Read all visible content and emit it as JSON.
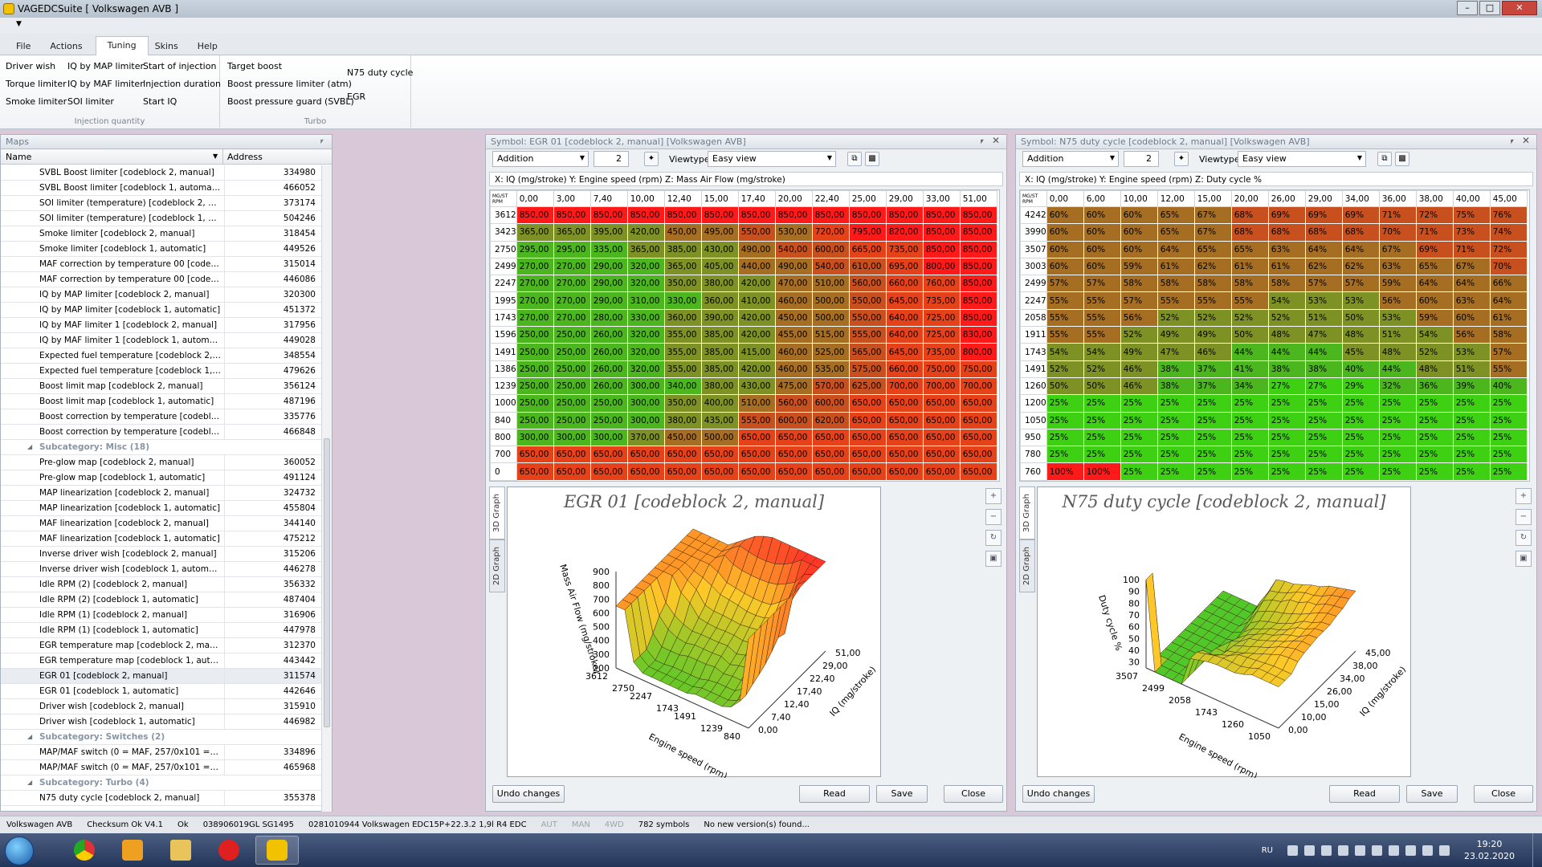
{
  "window": {
    "title": "VAGEDCSuite [ Volkswagen AVB ]"
  },
  "menu": [
    "File",
    "Actions",
    "Tuning",
    "Skins",
    "Help"
  ],
  "ribbon": {
    "injection": {
      "items": [
        "Driver wish",
        "IQ by MAP limiter",
        "Start of injection",
        "Torque limiter",
        "IQ by MAF limiter",
        "Injection duration",
        "Smoke limiter",
        "SOI limiter",
        "Start IQ"
      ],
      "label": "Injection quantity"
    },
    "turbo": {
      "items": [
        "Target boost",
        "Boost pressure limiter (atm)",
        "Boost pressure guard (SVBL)"
      ],
      "label": "Turbo"
    },
    "other": [
      "N75 duty cycle",
      "EGR"
    ]
  },
  "maps_panel": {
    "title": "Maps",
    "col_name": "Name",
    "col_address": "Address",
    "rows": [
      {
        "name": "SVBL Boost limiter [codeblock 2, manual]",
        "addr": "334980"
      },
      {
        "name": "SVBL Boost limiter [codeblock 1, automatic]",
        "addr": "466052"
      },
      {
        "name": "SOI limiter (temperature) [codeblock 2, man...",
        "addr": "373174"
      },
      {
        "name": "SOI limiter (temperature) [codeblock 1, auto...",
        "addr": "504246"
      },
      {
        "name": "Smoke limiter [codeblock 2, manual]",
        "addr": "318454"
      },
      {
        "name": "Smoke limiter [codeblock 1, automatic]",
        "addr": "449526"
      },
      {
        "name": "MAF correction by temperature 00 [codebloc...",
        "addr": "315014"
      },
      {
        "name": "MAF correction by temperature 00 [codebloc...",
        "addr": "446086"
      },
      {
        "name": "IQ by MAP limiter [codeblock 2, manual]",
        "addr": "320300"
      },
      {
        "name": "IQ by MAP limiter [codeblock 1, automatic]",
        "addr": "451372"
      },
      {
        "name": "IQ by MAF limiter 1 [codeblock 2, manual]",
        "addr": "317956"
      },
      {
        "name": "IQ by MAF limiter 1 [codeblock 1, automatic]",
        "addr": "449028"
      },
      {
        "name": "Expected fuel temperature [codeblock 2, ma...",
        "addr": "348554"
      },
      {
        "name": "Expected fuel temperature [codeblock 1, au...",
        "addr": "479626"
      },
      {
        "name": "Boost limit map [codeblock 2, manual]",
        "addr": "356124"
      },
      {
        "name": "Boost limit map [codeblock 1, automatic]",
        "addr": "487196"
      },
      {
        "name": "Boost correction by temperature [codeblock ...",
        "addr": "335776"
      },
      {
        "name": "Boost correction by temperature [codeblock ...",
        "addr": "466848"
      },
      {
        "name": "Subcategory: Misc (18)",
        "addr": "",
        "sub": true
      },
      {
        "name": "Pre-glow map [codeblock 2, manual]",
        "addr": "360052"
      },
      {
        "name": "Pre-glow map [codeblock 1, automatic]",
        "addr": "491124"
      },
      {
        "name": "MAP linearization [codeblock 2, manual]",
        "addr": "324732"
      },
      {
        "name": "MAP linearization [codeblock 1, automatic]",
        "addr": "455804"
      },
      {
        "name": "MAF linearization [codeblock 2, manual]",
        "addr": "344140"
      },
      {
        "name": "MAF linearization [codeblock 1, automatic]",
        "addr": "475212"
      },
      {
        "name": "Inverse driver wish [codeblock 2, manual]",
        "addr": "315206"
      },
      {
        "name": "Inverse driver wish [codeblock 1, automatic]",
        "addr": "446278"
      },
      {
        "name": "Idle RPM (2) [codeblock 2, manual]",
        "addr": "356332"
      },
      {
        "name": "Idle RPM (2) [codeblock 1, automatic]",
        "addr": "487404"
      },
      {
        "name": "Idle RPM (1) [codeblock 2, manual]",
        "addr": "316906"
      },
      {
        "name": "Idle RPM (1) [codeblock 1, automatic]",
        "addr": "447978"
      },
      {
        "name": "EGR temperature map [codeblock 2, manual]",
        "addr": "312370"
      },
      {
        "name": "EGR temperature map [codeblock 1, automa...",
        "addr": "443442"
      },
      {
        "name": "EGR 01 [codeblock 2, manual]",
        "addr": "311574",
        "sel": true
      },
      {
        "name": "EGR 01 [codeblock 1, automatic]",
        "addr": "442646"
      },
      {
        "name": "Driver wish [codeblock 2, manual]",
        "addr": "315910"
      },
      {
        "name": "Driver wish [codeblock 1, automatic]",
        "addr": "446982"
      },
      {
        "name": "Subcategory: Switches (2)",
        "addr": "",
        "sub": true
      },
      {
        "name": "MAP/MAF switch (0 = MAF, 257/0x101 = M...",
        "addr": "334896"
      },
      {
        "name": "MAP/MAF switch (0 = MAF, 257/0x101 = M...",
        "addr": "465968"
      },
      {
        "name": "Subcategory: Turbo (4)",
        "addr": "",
        "sub": true
      },
      {
        "name": "N75 duty cycle [codeblock 2, manual]",
        "addr": "355378"
      }
    ]
  },
  "egr_panel": {
    "title": "Symbol: EGR 01 [codeblock 2, manual] [Volkswagen AVB]",
    "mode": "Addition",
    "step": "2",
    "viewtype_label": "Viewtype",
    "viewtype": "Easy view",
    "axis_info": "X: IQ (mg/stroke) Y: Engine speed (rpm) Z: Mass Air Flow (mg/stroke)",
    "corner_top": "MG/ST",
    "corner_bottom": "RPM",
    "cols": [
      "0,00",
      "3,00",
      "7,40",
      "10,00",
      "12,40",
      "15,00",
      "17,40",
      "20,00",
      "22,40",
      "25,00",
      "29,00",
      "33,00",
      "51,00"
    ],
    "rows": [
      {
        "rpm": "3612",
        "v": [
          "850,00",
          "850,00",
          "850,00",
          "850,00",
          "850,00",
          "850,00",
          "850,00",
          "850,00",
          "850,00",
          "850,00",
          "850,00",
          "850,00",
          "850,00"
        ]
      },
      {
        "rpm": "3423",
        "v": [
          "365,00",
          "365,00",
          "395,00",
          "420,00",
          "450,00",
          "495,00",
          "550,00",
          "530,00",
          "720,00",
          "795,00",
          "820,00",
          "850,00",
          "850,00"
        ]
      },
      {
        "rpm": "2750",
        "v": [
          "295,00",
          "295,00",
          "335,00",
          "365,00",
          "385,00",
          "430,00",
          "490,00",
          "540,00",
          "600,00",
          "665,00",
          "735,00",
          "850,00",
          "850,00"
        ]
      },
      {
        "rpm": "2499",
        "v": [
          "270,00",
          "270,00",
          "290,00",
          "320,00",
          "365,00",
          "405,00",
          "440,00",
          "490,00",
          "540,00",
          "610,00",
          "695,00",
          "800,00",
          "850,00"
        ]
      },
      {
        "rpm": "2247",
        "v": [
          "270,00",
          "270,00",
          "290,00",
          "320,00",
          "350,00",
          "380,00",
          "420,00",
          "470,00",
          "510,00",
          "560,00",
          "660,00",
          "760,00",
          "850,00"
        ]
      },
      {
        "rpm": "1995",
        "v": [
          "270,00",
          "270,00",
          "290,00",
          "310,00",
          "330,00",
          "360,00",
          "410,00",
          "460,00",
          "500,00",
          "550,00",
          "645,00",
          "735,00",
          "850,00"
        ]
      },
      {
        "rpm": "1743",
        "v": [
          "270,00",
          "270,00",
          "280,00",
          "330,00",
          "360,00",
          "390,00",
          "420,00",
          "450,00",
          "500,00",
          "550,00",
          "640,00",
          "725,00",
          "850,00"
        ]
      },
      {
        "rpm": "1596",
        "v": [
          "250,00",
          "250,00",
          "260,00",
          "320,00",
          "355,00",
          "385,00",
          "420,00",
          "455,00",
          "515,00",
          "555,00",
          "640,00",
          "725,00",
          "830,00"
        ]
      },
      {
        "rpm": "1491",
        "v": [
          "250,00",
          "250,00",
          "260,00",
          "320,00",
          "355,00",
          "385,00",
          "415,00",
          "460,00",
          "525,00",
          "565,00",
          "645,00",
          "735,00",
          "800,00"
        ]
      },
      {
        "rpm": "1386",
        "v": [
          "250,00",
          "250,00",
          "260,00",
          "320,00",
          "355,00",
          "385,00",
          "420,00",
          "460,00",
          "535,00",
          "575,00",
          "660,00",
          "750,00",
          "750,00"
        ]
      },
      {
        "rpm": "1239",
        "v": [
          "250,00",
          "250,00",
          "260,00",
          "300,00",
          "340,00",
          "380,00",
          "430,00",
          "475,00",
          "570,00",
          "625,00",
          "700,00",
          "700,00",
          "700,00"
        ]
      },
      {
        "rpm": "1000",
        "v": [
          "250,00",
          "250,00",
          "250,00",
          "300,00",
          "350,00",
          "400,00",
          "510,00",
          "560,00",
          "600,00",
          "650,00",
          "650,00",
          "650,00",
          "650,00"
        ]
      },
      {
        "rpm": "840",
        "v": [
          "250,00",
          "250,00",
          "250,00",
          "300,00",
          "380,00",
          "435,00",
          "555,00",
          "600,00",
          "620,00",
          "650,00",
          "650,00",
          "650,00",
          "650,00"
        ]
      },
      {
        "rpm": "800",
        "v": [
          "300,00",
          "300,00",
          "300,00",
          "370,00",
          "450,00",
          "500,00",
          "650,00",
          "650,00",
          "650,00",
          "650,00",
          "650,00",
          "650,00",
          "650,00"
        ]
      },
      {
        "rpm": "700",
        "v": [
          "650,00",
          "650,00",
          "650,00",
          "650,00",
          "650,00",
          "650,00",
          "650,00",
          "650,00",
          "650,00",
          "650,00",
          "650,00",
          "650,00",
          "650,00"
        ]
      },
      {
        "rpm": "0",
        "v": [
          "650,00",
          "650,00",
          "650,00",
          "650,00",
          "650,00",
          "650,00",
          "650,00",
          "650,00",
          "650,00",
          "650,00",
          "650,00",
          "650,00",
          "650,00"
        ]
      }
    ],
    "graph_title": "EGR 01 [codeblock 2, manual]",
    "tab_3d": "3D Graph",
    "tab_2d": "2D Graph",
    "z_label": "Mass Air Flow (mg/stroke)",
    "z_ticks": [
      "900",
      "800",
      "700",
      "600",
      "500",
      "400",
      "300",
      "200"
    ],
    "y_label": "Engine speed (rpm)",
    "y_ticks": [
      "3612",
      "2750",
      "2247",
      "1743",
      "1491",
      "1239",
      "840"
    ],
    "x_label": "IQ (mg/stroke)",
    "x_ticks": [
      "51,00",
      "29,00",
      "22,40",
      "17,40",
      "12,40",
      "7,40",
      "0,00"
    ],
    "btn_undo": "Undo changes",
    "btn_read": "Read",
    "btn_save": "Save",
    "btn_close": "Close"
  },
  "n75_panel": {
    "title": "Symbol: N75 duty cycle [codeblock 2, manual] [Volkswagen AVB]",
    "mode": "Addition",
    "step": "2",
    "viewtype_label": "Viewtype",
    "viewtype": "Easy view",
    "axis_info": "X: IQ (mg/stroke) Y: Engine speed (rpm) Z: Duty cycle %",
    "corner_top": "MG/ST",
    "corner_bottom": "RPM",
    "cols": [
      "0,00",
      "6,00",
      "10,00",
      "12,00",
      "15,00",
      "20,00",
      "26,00",
      "29,00",
      "34,00",
      "36,00",
      "38,00",
      "40,00",
      "45,00"
    ],
    "rows": [
      {
        "rpm": "4242",
        "v": [
          "60%",
          "60%",
          "60%",
          "65%",
          "67%",
          "68%",
          "69%",
          "69%",
          "69%",
          "71%",
          "72%",
          "75%",
          "76%"
        ]
      },
      {
        "rpm": "3990",
        "v": [
          "60%",
          "60%",
          "60%",
          "65%",
          "67%",
          "68%",
          "68%",
          "68%",
          "68%",
          "70%",
          "71%",
          "73%",
          "74%"
        ]
      },
      {
        "rpm": "3507",
        "v": [
          "60%",
          "60%",
          "60%",
          "64%",
          "65%",
          "65%",
          "63%",
          "64%",
          "64%",
          "67%",
          "69%",
          "71%",
          "72%"
        ]
      },
      {
        "rpm": "3003",
        "v": [
          "60%",
          "60%",
          "59%",
          "61%",
          "62%",
          "61%",
          "61%",
          "62%",
          "62%",
          "63%",
          "65%",
          "67%",
          "70%"
        ]
      },
      {
        "rpm": "2499",
        "v": [
          "57%",
          "57%",
          "58%",
          "58%",
          "58%",
          "58%",
          "58%",
          "57%",
          "57%",
          "59%",
          "64%",
          "64%",
          "66%"
        ]
      },
      {
        "rpm": "2247",
        "v": [
          "55%",
          "55%",
          "57%",
          "55%",
          "55%",
          "55%",
          "54%",
          "53%",
          "53%",
          "56%",
          "60%",
          "63%",
          "64%"
        ]
      },
      {
        "rpm": "2058",
        "v": [
          "55%",
          "55%",
          "56%",
          "52%",
          "52%",
          "52%",
          "52%",
          "51%",
          "50%",
          "53%",
          "59%",
          "60%",
          "61%"
        ]
      },
      {
        "rpm": "1911",
        "v": [
          "55%",
          "55%",
          "52%",
          "49%",
          "49%",
          "50%",
          "48%",
          "47%",
          "48%",
          "51%",
          "54%",
          "56%",
          "58%"
        ]
      },
      {
        "rpm": "1743",
        "v": [
          "54%",
          "54%",
          "49%",
          "47%",
          "46%",
          "44%",
          "44%",
          "44%",
          "45%",
          "48%",
          "52%",
          "53%",
          "57%"
        ]
      },
      {
        "rpm": "1491",
        "v": [
          "52%",
          "52%",
          "46%",
          "38%",
          "37%",
          "41%",
          "38%",
          "38%",
          "40%",
          "44%",
          "48%",
          "51%",
          "55%"
        ]
      },
      {
        "rpm": "1260",
        "v": [
          "50%",
          "50%",
          "46%",
          "38%",
          "37%",
          "34%",
          "27%",
          "27%",
          "29%",
          "32%",
          "36%",
          "39%",
          "40%"
        ]
      },
      {
        "rpm": "1200",
        "v": [
          "25%",
          "25%",
          "25%",
          "25%",
          "25%",
          "25%",
          "25%",
          "25%",
          "25%",
          "25%",
          "25%",
          "25%",
          "25%"
        ]
      },
      {
        "rpm": "1050",
        "v": [
          "25%",
          "25%",
          "25%",
          "25%",
          "25%",
          "25%",
          "25%",
          "25%",
          "25%",
          "25%",
          "25%",
          "25%",
          "25%"
        ]
      },
      {
        "rpm": "950",
        "v": [
          "25%",
          "25%",
          "25%",
          "25%",
          "25%",
          "25%",
          "25%",
          "25%",
          "25%",
          "25%",
          "25%",
          "25%",
          "25%"
        ]
      },
      {
        "rpm": "780",
        "v": [
          "25%",
          "25%",
          "25%",
          "25%",
          "25%",
          "25%",
          "25%",
          "25%",
          "25%",
          "25%",
          "25%",
          "25%",
          "25%"
        ]
      },
      {
        "rpm": "760",
        "v": [
          "100%",
          "100%",
          "25%",
          "25%",
          "25%",
          "25%",
          "25%",
          "25%",
          "25%",
          "25%",
          "25%",
          "25%",
          "25%"
        ]
      }
    ],
    "graph_title": "N75 duty cycle [codeblock 2, manual]",
    "tab_3d": "3D Graph",
    "tab_2d": "2D Graph",
    "z_label": "Duty cycle %",
    "z_ticks": [
      "100",
      "90",
      "80",
      "70",
      "60",
      "50",
      "40",
      "30"
    ],
    "y_label": "Engine speed (rpm)",
    "y_ticks": [
      "3507",
      "2499",
      "2058",
      "1743",
      "1260",
      "1050"
    ],
    "x_label": "IQ (mg/stroke)",
    "x_ticks": [
      "45,00",
      "38,00",
      "34,00",
      "26,00",
      "15,00",
      "10,00",
      "0,00"
    ],
    "btn_undo": "Undo changes",
    "btn_read": "Read",
    "btn_save": "Save",
    "btn_close": "Close"
  },
  "statusbar": {
    "car": "Volkswagen AVB",
    "checksum": "Checksum Ok V4.1",
    "ok": "Ok",
    "partno": "038906019GL SG1495",
    "ecu": "0281010944 Volkswagen EDC15P+22.3.2 1,9l R4 EDC",
    "aut": "AUT",
    "man": "MAN",
    "wd": "4WD",
    "symbols": "782 symbols",
    "version": "No new version(s) found..."
  },
  "taskbar": {
    "lang": "RU",
    "time": "19:20",
    "date": "23.02.2020"
  }
}
